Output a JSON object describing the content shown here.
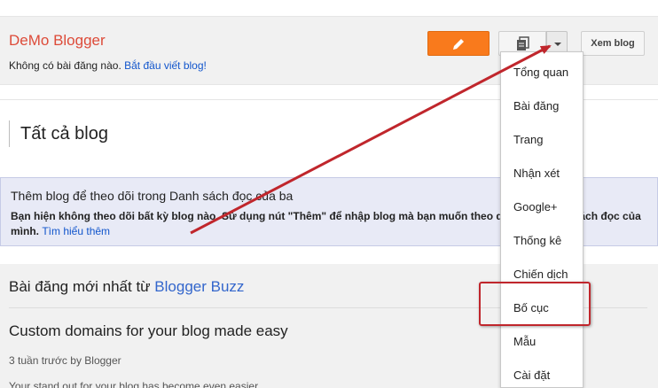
{
  "blog": {
    "title": "DeMo Blogger",
    "empty_text": "Không có bài đăng nào.",
    "start_link": "Bắt đầu viết blog!",
    "view_button": "Xem blog"
  },
  "all_blogs": {
    "title": "Tất cả blog"
  },
  "follow": {
    "title": "Thêm blog để theo dõi trong Danh sách đọc của ba",
    "text": "Bạn hiện không theo dõi bất kỳ blog nào. Sử dụng nút \"Thêm\" để nhập blog mà bạn muốn theo dõi trong danh sách đọc của mình.",
    "learn_more": "Tìm hiểu thêm"
  },
  "latest": {
    "title_prefix": "Bài đăng mới nhất từ",
    "title_link": "Blogger Buzz",
    "post_title": "Custom domains for your blog made easy",
    "post_meta": "3 tuần trước by Blogger",
    "post_snippet": "Your stand out for your blog has become even easier..."
  },
  "dropdown": {
    "items": [
      "Tổng quan",
      "Bài đăng",
      "Trang",
      "Nhận xét",
      "Google+",
      "Thống kê",
      "Chiến dịch",
      "Bố cục",
      "Mẫu",
      "Cài đặt"
    ],
    "highlighted": "Bố cục"
  },
  "colors": {
    "brand_title": "#dd4b39",
    "edit_button": "#f97a1c",
    "link": "#1155cc",
    "annotation": "#c0262c"
  },
  "icons": {
    "edit": "pencil-icon",
    "posts": "document-icon",
    "caret": "chevron-down-icon"
  }
}
